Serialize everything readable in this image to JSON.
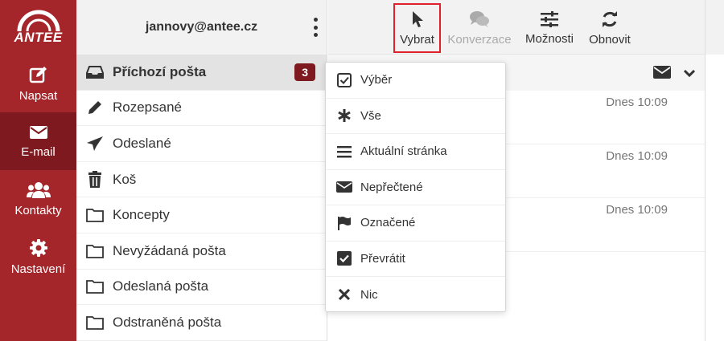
{
  "brand": {
    "logo_text": "ANTEE",
    "color": "#a4262b",
    "active_color": "#7e1a1f"
  },
  "rail": {
    "items": [
      {
        "label": "Napsat",
        "icon": "compose-icon"
      },
      {
        "label": "E-mail",
        "icon": "envelope-icon",
        "active": true
      },
      {
        "label": "Kontakty",
        "icon": "users-icon"
      },
      {
        "label": "Nastavení",
        "icon": "gear-icon"
      }
    ]
  },
  "account": {
    "email": "jannovy@antee.cz"
  },
  "folders": [
    {
      "label": "Příchozí pošta",
      "icon": "inbox-icon",
      "active": true,
      "unread": "3"
    },
    {
      "label": "Rozepsané",
      "icon": "pencil-icon"
    },
    {
      "label": "Odeslané",
      "icon": "paper-plane-icon"
    },
    {
      "label": "Koš",
      "icon": "trash-icon"
    },
    {
      "label": "Koncepty",
      "icon": "folder-icon"
    },
    {
      "label": "Nevyžádaná pošta",
      "icon": "folder-icon"
    },
    {
      "label": "Odeslaná pošta",
      "icon": "folder-icon"
    },
    {
      "label": "Odstraněná pošta",
      "icon": "folder-icon"
    }
  ],
  "toolbar": {
    "buttons": [
      {
        "label": "Vybrat",
        "icon": "cursor-icon",
        "selected": true
      },
      {
        "label": "Konverzace",
        "icon": "comments-icon",
        "disabled": true
      },
      {
        "label": "Možnosti",
        "icon": "sliders-icon"
      },
      {
        "label": "Obnovit",
        "icon": "refresh-icon"
      }
    ]
  },
  "messages": [
    {
      "time": "Dnes 10:09"
    },
    {
      "time": "Dnes 10:09"
    },
    {
      "time": "Dnes 10:09"
    }
  ],
  "select_menu": {
    "items": [
      {
        "label": "Výběr",
        "icon": "checkbox-outline-icon"
      },
      {
        "label": "Vše",
        "icon": "asterisk-icon"
      },
      {
        "label": "Aktuální stránka",
        "icon": "bars-icon"
      },
      {
        "label": "Nepřečtené",
        "icon": "envelope-icon"
      },
      {
        "label": "Označené",
        "icon": "flag-icon"
      },
      {
        "label": "Převrátit",
        "icon": "checkbox-checked-icon"
      },
      {
        "label": "Nic",
        "icon": "close-icon"
      }
    ]
  }
}
